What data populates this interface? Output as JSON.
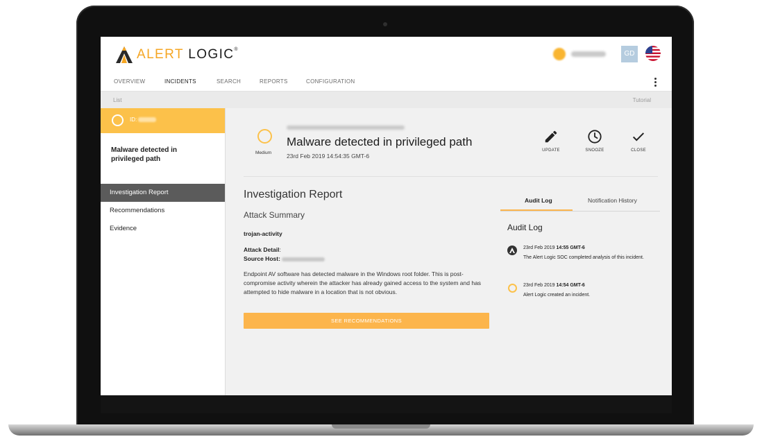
{
  "brand": {
    "logo_word_1": "ALERT",
    "logo_word_2": "LOGIC",
    "registered_mark": "®"
  },
  "account": {
    "avatar_initials": "GD"
  },
  "nav": {
    "items": [
      "OVERVIEW",
      "INCIDENTS",
      "SEARCH",
      "REPORTS",
      "CONFIGURATION"
    ],
    "active": "INCIDENTS"
  },
  "breadcrumb": {
    "list": "List",
    "tutorial": "Tutorial"
  },
  "sidebar": {
    "id_label": "ID:",
    "incident_title": "Malware detected in privileged path",
    "menu": [
      "Investigation Report",
      "Recommendations",
      "Evidence"
    ],
    "active_menu": "Investigation Report"
  },
  "incident": {
    "severity": "Medium",
    "title": "Malware detected in privileged path",
    "date": "23rd Feb 2019 14:54:35 GMT-6",
    "actions": {
      "update": "UPDATE",
      "snooze": "SNOOZE",
      "close": "CLOSE"
    }
  },
  "report": {
    "heading": "Investigation Report",
    "attack_summary": "Attack Summary",
    "attack_type": "trojan-activity",
    "attack_detail_label": "Attack Detail",
    "source_host_label": "Source Host",
    "description": "Endpoint AV software has detected malware in the Windows root folder. This is post-compromise activity wherein the attacker has already gained access to the system and has attempted to hide malware in a location that is not obvious.",
    "button": "SEE RECOMMENDATIONS"
  },
  "audit": {
    "tabs": [
      "Audit Log",
      "Notification History"
    ],
    "active_tab": "Audit Log",
    "heading": "Audit Log",
    "entries": [
      {
        "date_prefix": "23rd Feb 2019",
        "time": "14:55 GMT-6",
        "text": "The Alert Logic SOC completed analysis of this incident.",
        "icon": "alertlogic-a-icon"
      },
      {
        "date_prefix": "23rd Feb 2019",
        "time": "14:54 GMT-6",
        "text": "Alert Logic created an incident.",
        "icon": "ring-icon"
      }
    ]
  },
  "colors": {
    "accent": "#fcb54c",
    "severity_medium": "#fcc14a",
    "sidebar_active": "#5b5b5b"
  }
}
